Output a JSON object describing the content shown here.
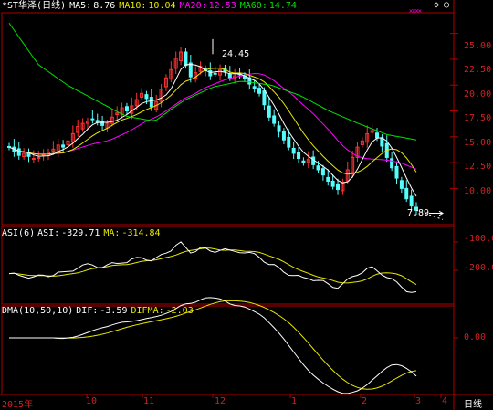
{
  "colors": {
    "bg": "#000000",
    "frame": "#b00000",
    "up": "#ff3232",
    "down": "#54fcfc",
    "ma5": "#ffffff",
    "ma10": "#e8e800",
    "ma20": "#ff00ff",
    "ma60": "#00e000",
    "axis_text": "#cc2222",
    "asi": "#ffffff",
    "asi_ma": "#e8e800",
    "dif": "#ffffff",
    "difma": "#e8e800"
  },
  "price_panel": {
    "stock": "*ST华泽(日线)",
    "ma5_label": "MA5:",
    "ma5_value": "8.76",
    "ma10_label": "MA10:",
    "ma10_value": "10.04",
    "ma20_label": "MA20:",
    "ma20_value": "12.53",
    "ma60_label": "MA60:",
    "ma60_value": "14.74",
    "high_marker": "24.45",
    "low_marker": "7.89",
    "y_ticks": [
      "25.00",
      "22.50",
      "20.00",
      "17.50",
      "15.00",
      "12.50",
      "10.00"
    ]
  },
  "asi_panel": {
    "name": "ASI(6)",
    "asi_label": "ASI:",
    "asi_value": "-329.71",
    "ma_label": "MA:",
    "ma_value": "-314.84",
    "y_ticks": [
      "-100.0",
      "-200.0"
    ]
  },
  "dma_panel": {
    "name": "DMA(10,50,10)",
    "dif_label": "DIF:",
    "dif_value": "-3.59",
    "difma_label": "DIFMA:",
    "difma_value": "-2.03",
    "y_ticks": [
      "0.00"
    ]
  },
  "x_axis": {
    "labels": [
      "2015年",
      "10",
      "11",
      "12",
      "1",
      "2",
      "3",
      "4"
    ],
    "period_button": "日线"
  },
  "chart_data": {
    "type": "candlestick",
    "y_range": [
      6.5,
      27.0
    ],
    "highest": 24.45,
    "lowest": 7.89,
    "close_series": [
      14.0,
      13.6,
      13.2,
      13.4,
      13.1,
      12.9,
      13.0,
      13.3,
      13.5,
      13.8,
      14.2,
      14.0,
      14.6,
      15.3,
      16.0,
      16.3,
      16.5,
      16.7,
      16.4,
      16.1,
      16.3,
      16.9,
      17.3,
      17.8,
      17.5,
      18.0,
      18.6,
      19.2,
      18.7,
      17.9,
      18.4,
      19.6,
      20.7,
      21.5,
      22.6,
      23.2,
      21.9,
      20.8,
      21.2,
      21.8,
      21.4,
      20.9,
      21.1,
      21.5,
      21.3,
      20.7,
      20.9,
      21.0,
      20.6,
      20.1,
      19.7,
      19.2,
      18.1,
      16.9,
      16.3,
      15.5,
      14.7,
      14.0,
      13.4,
      12.9,
      12.5,
      12.8,
      12.3,
      11.8,
      11.3,
      10.7,
      10.2,
      9.9,
      10.6,
      11.8,
      13.0,
      14.0,
      14.6,
      15.3,
      15.6,
      14.9,
      14.1,
      13.0,
      12.0,
      11.0,
      10.0,
      9.0,
      8.3,
      7.89
    ],
    "ma5": 8.76,
    "ma10": 10.04,
    "ma20": 12.53,
    "ma60": 14.74
  }
}
